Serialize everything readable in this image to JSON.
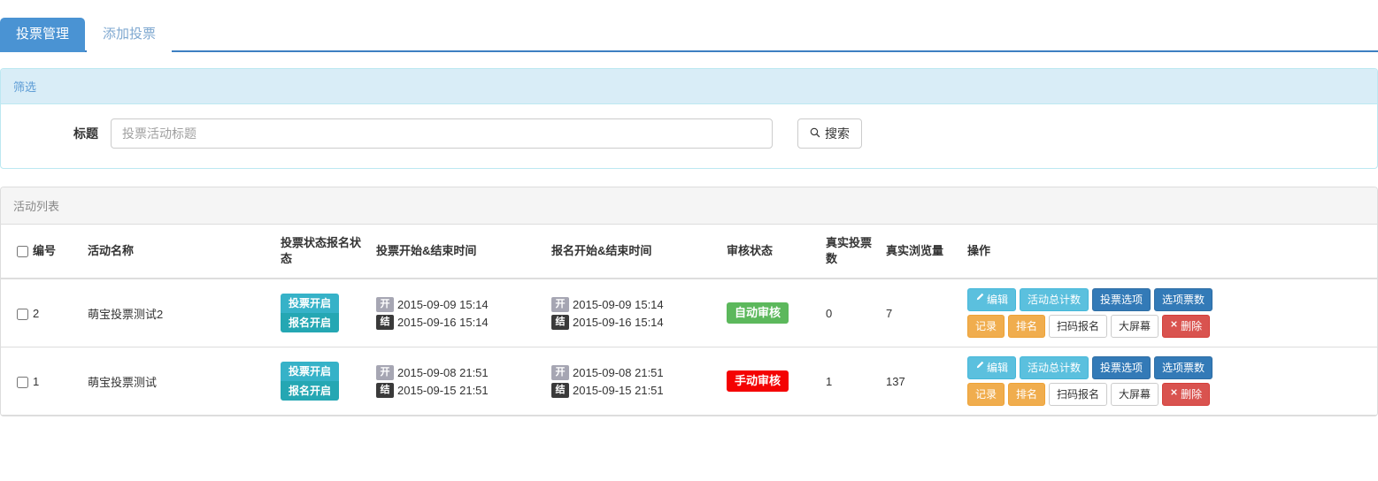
{
  "tabs": [
    {
      "label": "投票管理",
      "active": true
    },
    {
      "label": "添加投票",
      "active": false
    }
  ],
  "filter_panel": {
    "title": "筛选",
    "form": {
      "label": "标题",
      "input_value": "",
      "input_placeholder": "投票活动标题",
      "search_button": "搜索",
      "search_icon": "search-icon"
    }
  },
  "list_panel": {
    "title": "活动列表",
    "columns": [
      "编号",
      "活动名称",
      "投票状态报名状态",
      "投票开始&结束时间",
      "报名开始&结束时间",
      "审核状态",
      "真实投票数",
      "真实浏览量",
      "操作"
    ],
    "rows": [
      {
        "id": "2",
        "name": "萌宝投票测试2",
        "vote_state": "投票开启",
        "reg_state": "报名开启",
        "vote_start_tag": "开",
        "vote_start": "2015-09-09 15:14",
        "vote_end_tag": "结",
        "vote_end": "2015-09-16 15:14",
        "reg_start_tag": "开",
        "reg_start": "2015-09-09 15:14",
        "reg_end_tag": "结",
        "reg_end": "2015-09-16 15:14",
        "audit": "自动审核",
        "audit_type": "auto",
        "real_votes": "0",
        "real_views": "7",
        "actions": [
          {
            "label": "编辑",
            "style": "info",
            "icon": "pencil-icon"
          },
          {
            "label": "活动总计数",
            "style": "info",
            "icon": ""
          },
          {
            "label": "投票选项",
            "style": "primary",
            "icon": ""
          },
          {
            "label": "选项票数",
            "style": "primary",
            "icon": ""
          },
          {
            "label": "记录",
            "style": "warning",
            "icon": ""
          },
          {
            "label": "排名",
            "style": "warning",
            "icon": ""
          },
          {
            "label": "扫码报名",
            "style": "default",
            "icon": ""
          },
          {
            "label": "大屏幕",
            "style": "default",
            "icon": ""
          },
          {
            "label": "删除",
            "style": "danger",
            "icon": "remove-icon"
          }
        ]
      },
      {
        "id": "1",
        "name": "萌宝投票测试",
        "vote_state": "投票开启",
        "reg_state": "报名开启",
        "vote_start_tag": "开",
        "vote_start": "2015-09-08 21:51",
        "vote_end_tag": "结",
        "vote_end": "2015-09-15 21:51",
        "reg_start_tag": "开",
        "reg_start": "2015-09-08 21:51",
        "reg_end_tag": "结",
        "reg_end": "2015-09-15 21:51",
        "audit": "手动审核",
        "audit_type": "manual",
        "real_votes": "1",
        "real_views": "137",
        "actions": [
          {
            "label": "编辑",
            "style": "info",
            "icon": "pencil-icon"
          },
          {
            "label": "活动总计数",
            "style": "info",
            "icon": ""
          },
          {
            "label": "投票选项",
            "style": "primary",
            "icon": ""
          },
          {
            "label": "选项票数",
            "style": "primary",
            "icon": ""
          },
          {
            "label": "记录",
            "style": "warning",
            "icon": ""
          },
          {
            "label": "排名",
            "style": "warning",
            "icon": ""
          },
          {
            "label": "扫码报名",
            "style": "default",
            "icon": ""
          },
          {
            "label": "大屏幕",
            "style": "default",
            "icon": ""
          },
          {
            "label": "删除",
            "style": "danger",
            "icon": "remove-icon"
          }
        ]
      }
    ]
  },
  "colors": {
    "tab_active": "#4a93d3",
    "tab_border": "#3d7fc1",
    "panel_info_head": "#d9edf7",
    "badge_vote": "#36b2c8",
    "badge_reg": "#25a7b3",
    "audit_auto": "#5cb85c",
    "audit_manual": "#f40303"
  }
}
